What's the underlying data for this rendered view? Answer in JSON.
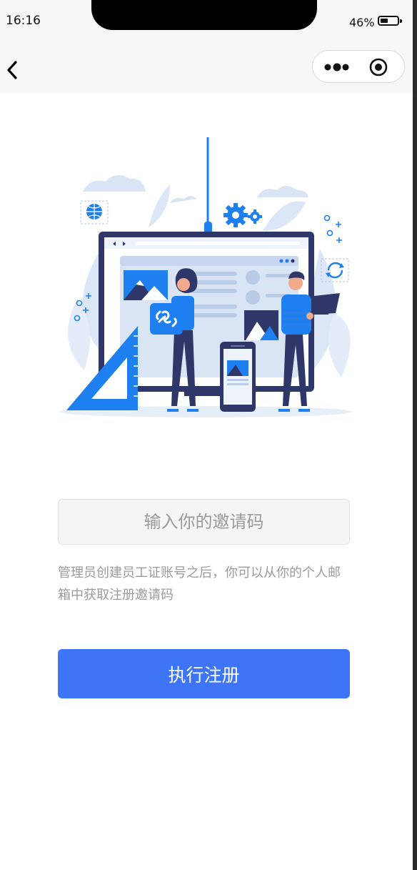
{
  "status_bar": {
    "time": "16:16",
    "battery_percent": "46%",
    "battery_level": 0.46
  },
  "nav": {
    "back_icon": "chevron-left-icon",
    "capsule_more_icon": "more-dots-icon",
    "capsule_close_icon": "target-circle-icon"
  },
  "illustration": {
    "icon": "web-design-team-illustration"
  },
  "form": {
    "invite_code_placeholder": "输入你的邀请码",
    "invite_code_value": "",
    "hint": "管理员创建员工证账号之后，你可以从你的个人邮箱中获取注册邀请码",
    "submit_label": "执行注册"
  },
  "colors": {
    "primary": "#3d75f6",
    "illustration_blue": "#1e7ff0",
    "illustration_dark": "#2f3769",
    "illustration_light": "#d9e4f5",
    "hint_text": "#9b9b9b",
    "input_bg": "#f5f5f5"
  }
}
